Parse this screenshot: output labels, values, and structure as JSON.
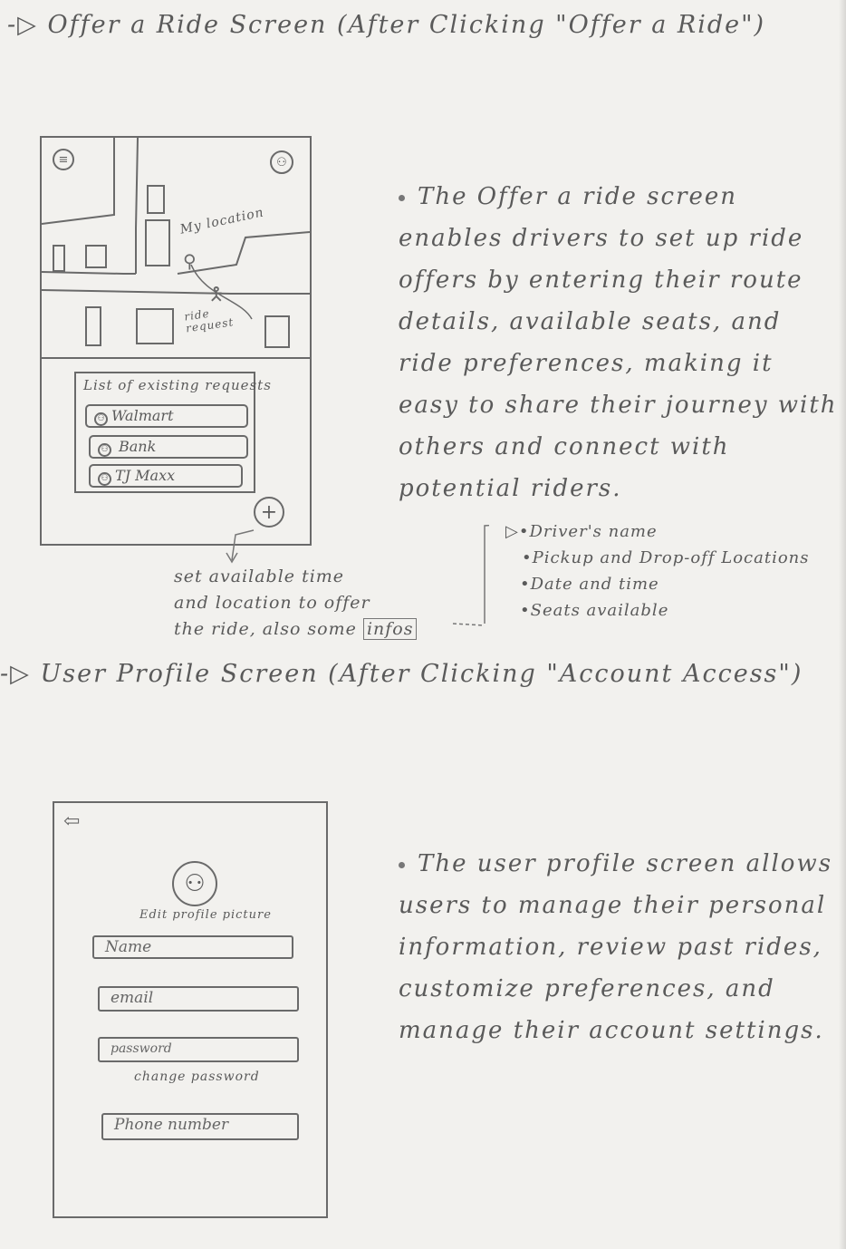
{
  "section1": {
    "heading_arrow": "-▷",
    "heading": "Offer a Ride Screen (After Clicking \"Offer a Ride\")",
    "mockup": {
      "menu_icon": "menu-icon",
      "profile_icon": "profile-icon",
      "my_location_label": "My location",
      "ride_request_label": "ride request",
      "list_title": "List of existing requests",
      "requests": [
        {
          "icon": "user-icon",
          "label": "Walmart"
        },
        {
          "icon": "user-icon",
          "label": "Bank"
        },
        {
          "icon": "user-icon",
          "label": "TJ Maxx"
        }
      ],
      "add_button": "+"
    },
    "description": "The Offer a ride screen enables drivers to set up ride offers by entering their route details, available seats, and ride preferences, making it easy to share their journey with others and connect with potential riders.",
    "annotation_line1": "set available time",
    "annotation_line2": "and location to offer",
    "annotation_line3": "the ride, also some",
    "annotation_boxed": "infos",
    "info_arrow": "▷",
    "info_items": [
      "Driver's name",
      "Pickup and Drop-off Locations",
      "Date and time",
      "Seats available"
    ]
  },
  "section2": {
    "heading_arrow": "-▷",
    "heading": "User Profile Screen (After Clicking \"Account Access\")",
    "mockup": {
      "back_icon": "back-arrow-icon",
      "avatar_icon": "avatar-icon",
      "edit_picture_label": "Edit profile picture",
      "name_field": "Name",
      "email_field": "email",
      "password_field": "password",
      "change_password_link": "change password",
      "phone_field": "Phone number"
    },
    "description": "The user profile screen allows users to manage their personal information, review past rides, customize preferences, and manage their account settings."
  }
}
